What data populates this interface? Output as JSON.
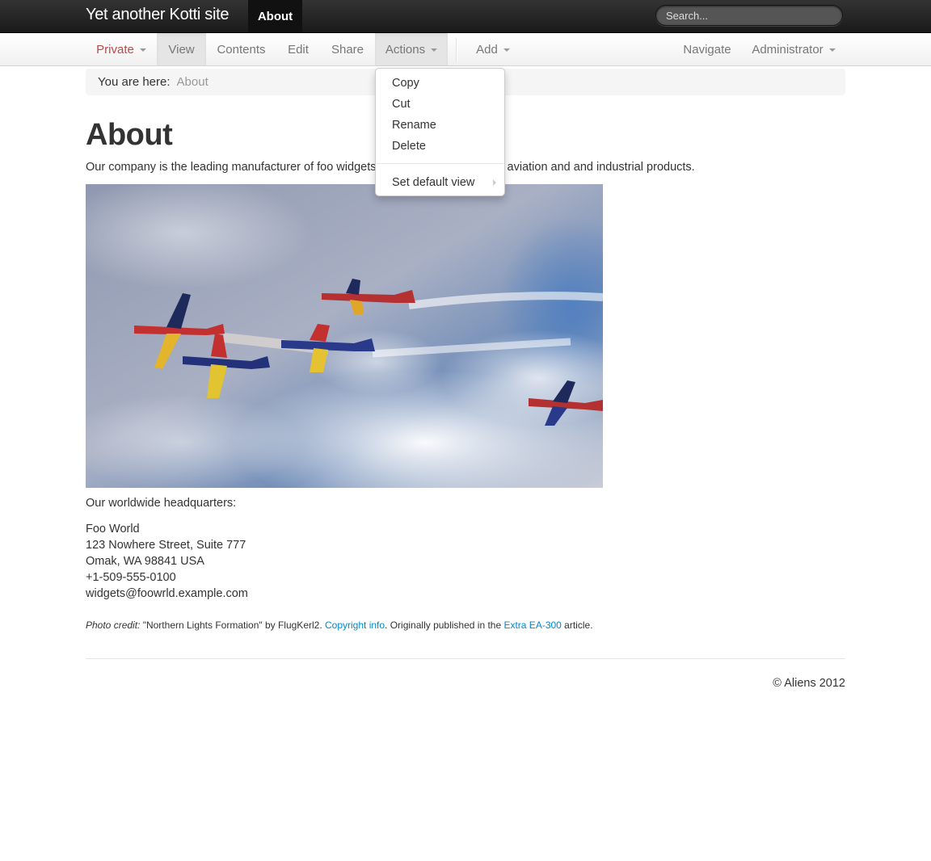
{
  "topbar": {
    "brand": "Yet another Kotti site",
    "active_tab": "About",
    "search_placeholder": "Search..."
  },
  "subnav": {
    "state": "Private",
    "view": "View",
    "contents": "Contents",
    "edit": "Edit",
    "share": "Share",
    "actions": "Actions",
    "add": "Add",
    "navigate": "Navigate",
    "user": "Administrator"
  },
  "breadcrumb": {
    "label": "You are here:",
    "current": "About"
  },
  "actions_menu": {
    "items": [
      "Copy",
      "Cut",
      "Rename",
      "Delete"
    ],
    "set_default_view": "Set default view"
  },
  "content": {
    "title": "About",
    "intro_part1": "Our company is the leading manufacturer of foo widgets",
    "intro_part2": "aviation and and industrial products.",
    "hq_label": "Our worldwide headquarters:",
    "address": [
      "Foo World",
      "123 Nowhere Street, Suite 777",
      "Omak, WA 98841 USA",
      "+1-509-555-0100",
      "widgets@foowrld.example.com"
    ],
    "credit": {
      "prefix": "Photo credit:",
      "text1": " \"Northern Lights Formation\" by FlugKerl2. ",
      "link1": "Copyright info",
      "text2": ". Originally published in the ",
      "link2": "Extra EA-300",
      "text3": " article."
    }
  },
  "footer": {
    "text": "© Aliens 2012"
  },
  "colors": {
    "link": "#0088cc",
    "private": "#b94a48",
    "topbar": "#1a1a1a"
  }
}
